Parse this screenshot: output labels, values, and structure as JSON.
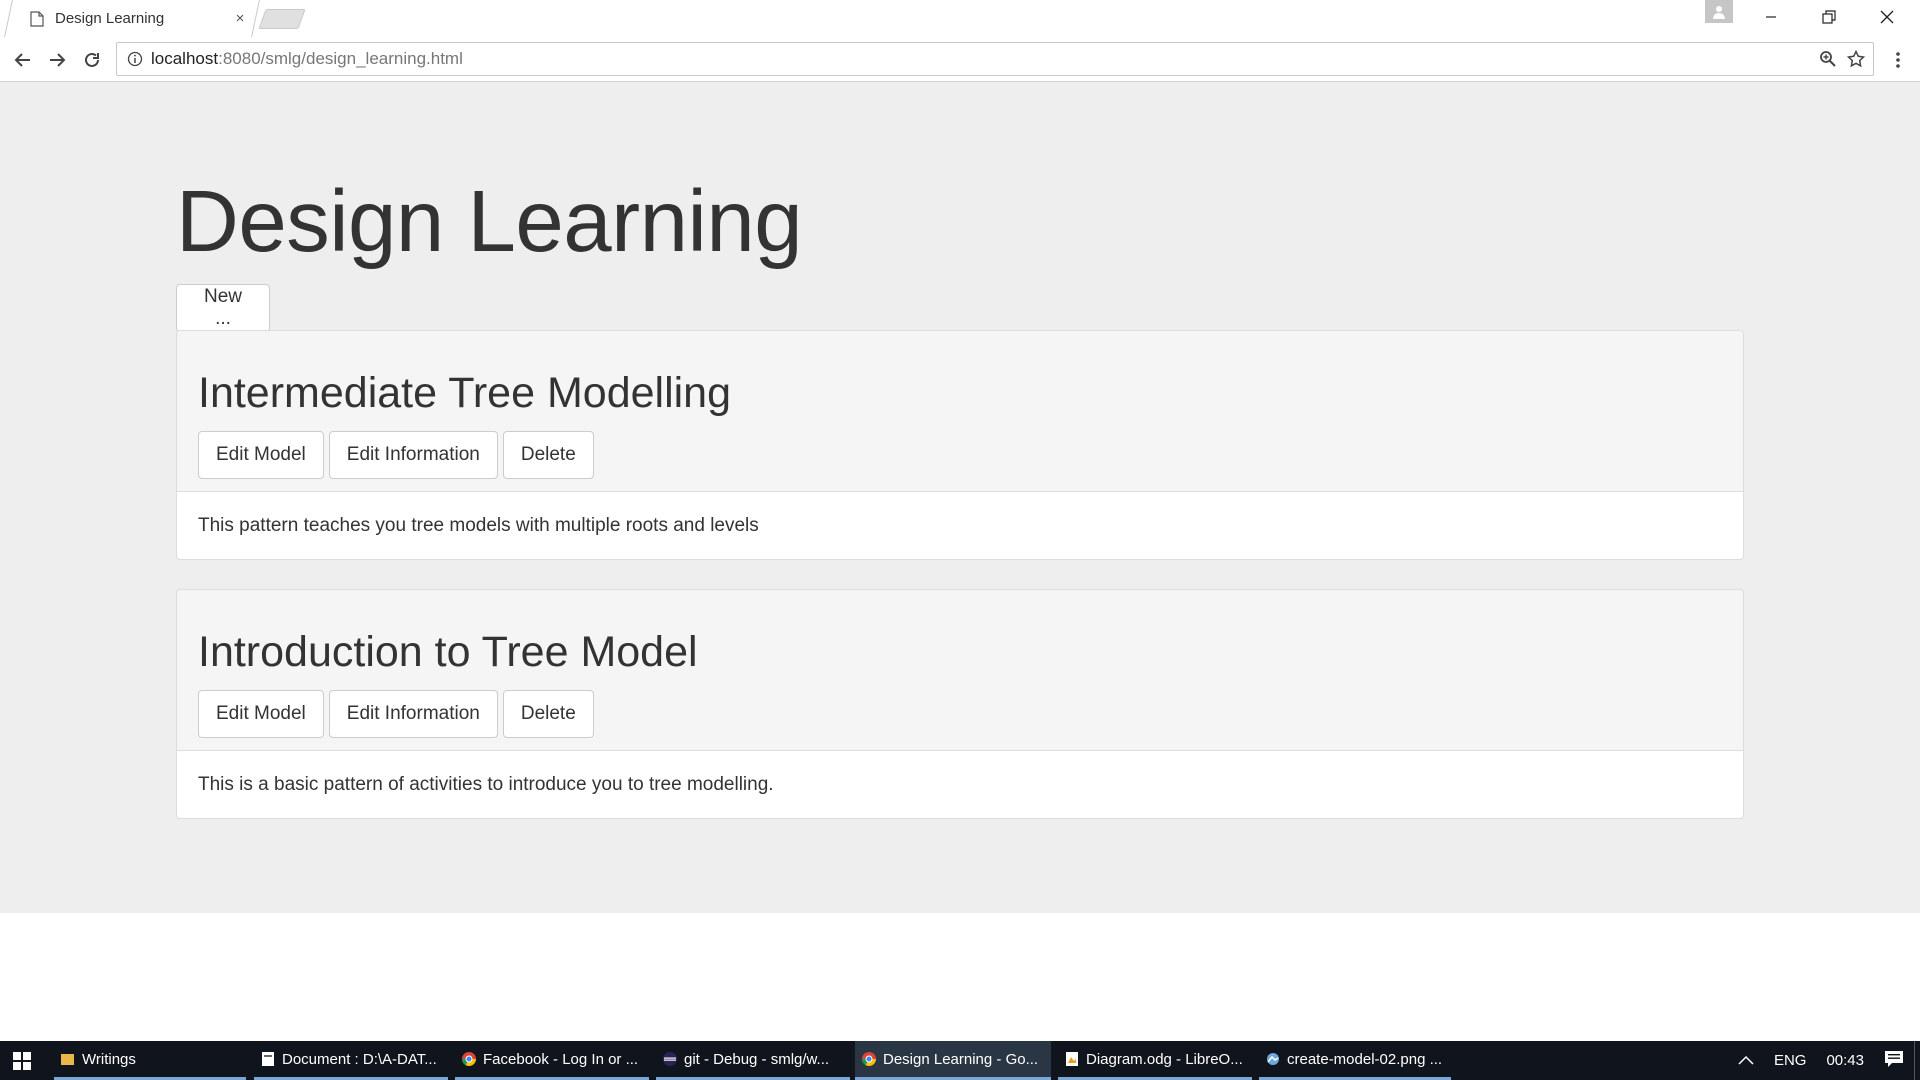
{
  "browser": {
    "tab_title": "Design Learning",
    "tab_close": "×",
    "url_host": "localhost",
    "url_path": ":8080/smlg/design_learning.html"
  },
  "page": {
    "title": "Design Learning",
    "new_button": "New ..."
  },
  "cards": [
    {
      "title": "Intermediate Tree Modelling",
      "edit_model": "Edit Model",
      "edit_information": "Edit Information",
      "delete": "Delete",
      "description": "This pattern teaches you tree models with multiple roots and levels"
    },
    {
      "title": "Introduction to Tree Model",
      "edit_model": "Edit Model",
      "edit_information": "Edit Information",
      "delete": "Delete",
      "description": "This is a basic pattern of activities to introduce you to tree modelling."
    }
  ],
  "taskbar": {
    "items": [
      {
        "label": "Writings",
        "icon": "folder-icon"
      },
      {
        "label": "Document : D:\\A-DAT...",
        "icon": "document-icon"
      },
      {
        "label": "Facebook - Log In or ...",
        "icon": "chrome-icon"
      },
      {
        "label": "git - Debug - smlg/w...",
        "icon": "eclipse-icon"
      },
      {
        "label": "Design Learning - Go...",
        "icon": "chrome-icon"
      },
      {
        "label": "Diagram.odg - LibreO...",
        "icon": "libreoffice-draw-icon"
      },
      {
        "label": "create-model-02.png ...",
        "icon": "image-viewer-icon"
      }
    ],
    "language": "ENG",
    "time": "00:43"
  },
  "colors": {
    "page_background": "#eeeeee",
    "card_header": "#f5f5f5",
    "taskbar": "#10151d",
    "taskbar_accent": "#7aa7d9"
  }
}
